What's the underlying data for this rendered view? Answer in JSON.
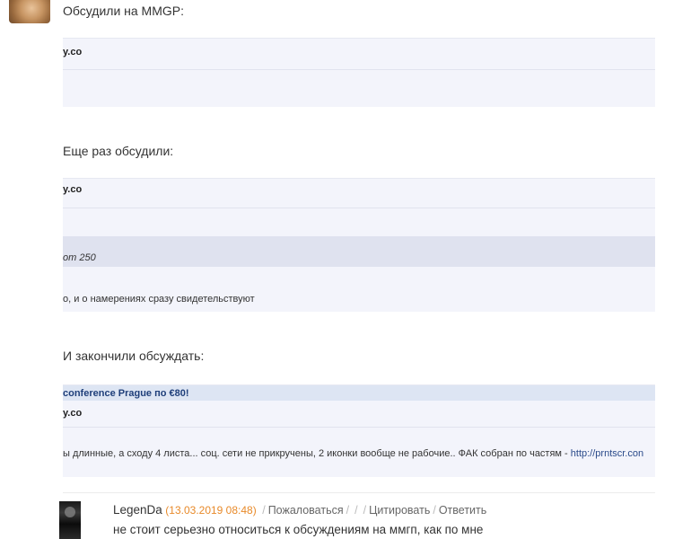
{
  "headings": {
    "first": "Обсудили на MMGP:",
    "second": "Еще раз обсудили:",
    "third": "И закончили обсуждать:"
  },
  "shot1": {
    "domain": "y.co"
  },
  "shot2": {
    "domain": "y.co",
    "price": "от 250",
    "line": "о, и о намерениях сразу свидетельствуют"
  },
  "shot3": {
    "banner": "conference Prague по €80!",
    "domain": "y.co",
    "line": "ы длинные, а сходу 4 листа... соц. сети не прикручены, 2 иконки вообще не рабочие.. ФАК собран по частям -",
    "link": "http://prntscr.con"
  },
  "comment": {
    "author": "LegenDa",
    "date": "(13.03.2019 08:48)",
    "actions": [
      "Пожаловаться",
      "Цитировать",
      "Ответить"
    ],
    "text": "не стоит серьезно относиться к обсуждениям на ммгп, как по мне"
  }
}
